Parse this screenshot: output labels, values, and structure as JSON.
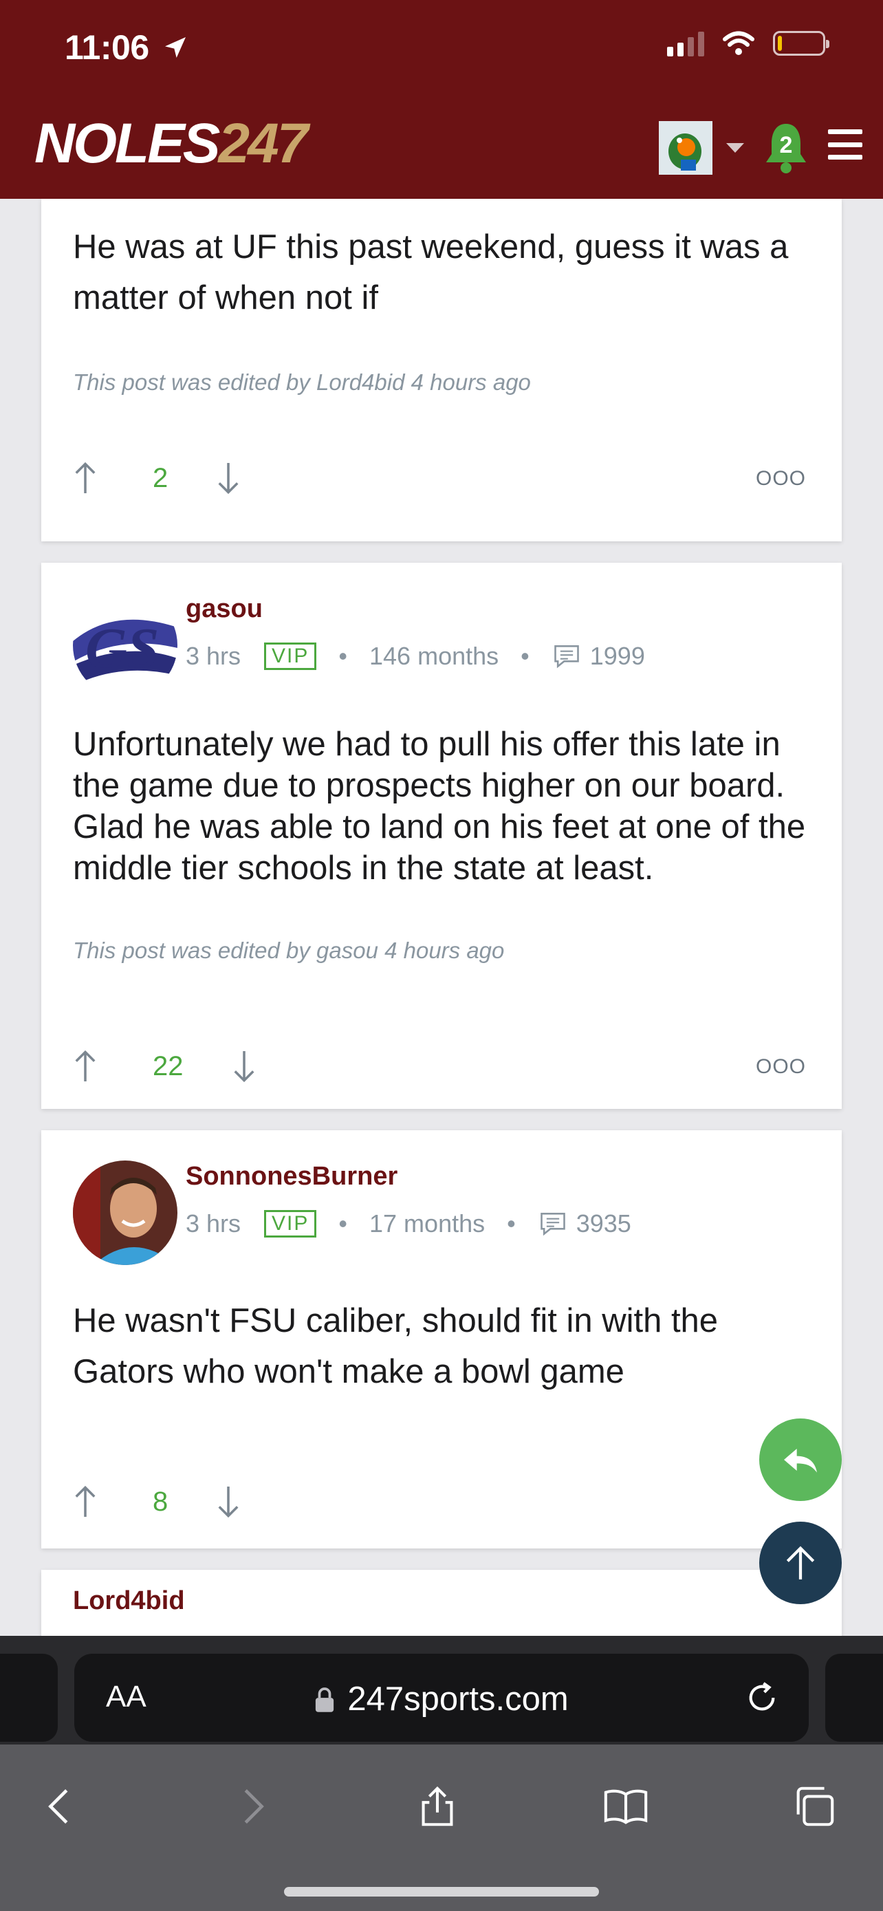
{
  "status_bar": {
    "time": "11:06"
  },
  "header": {
    "logo_part1": "NOLES",
    "logo_part2": "247",
    "notification_count": "2"
  },
  "posts": [
    {
      "body": "He was at UF this past weekend, guess it was a matter of when not if",
      "edited": "This post was edited by Lord4bid 4 hours ago",
      "votes": "2",
      "more": "OOO"
    },
    {
      "username": "gasou",
      "time": "3 hrs",
      "badge": "VIP",
      "tenure": "146 months",
      "post_count": "1999",
      "body": "Unfortunately we had to pull his offer this late in the game due to prospects higher on our board. Glad he was able to land on his feet at one of the middle tier schools in the state at least.",
      "edited": "This post was edited by gasou 4 hours ago",
      "votes": "22",
      "more": "OOO"
    },
    {
      "username": "SonnonesBurner",
      "time": "3 hrs",
      "badge": "VIP",
      "tenure": "17 months",
      "post_count": "3935",
      "body": "He wasn't FSU caliber, should fit in with the Gators who won't make a bowl game",
      "votes": "8"
    },
    {
      "username": "Lord4bid"
    }
  ],
  "browser": {
    "text_size_label": "AA",
    "url": "247sports.com"
  },
  "colors": {
    "header_bg": "#6b1214",
    "username": "#6b1214",
    "accent_green": "#4ca83f",
    "scroll_top_bg": "#1e3b52"
  }
}
